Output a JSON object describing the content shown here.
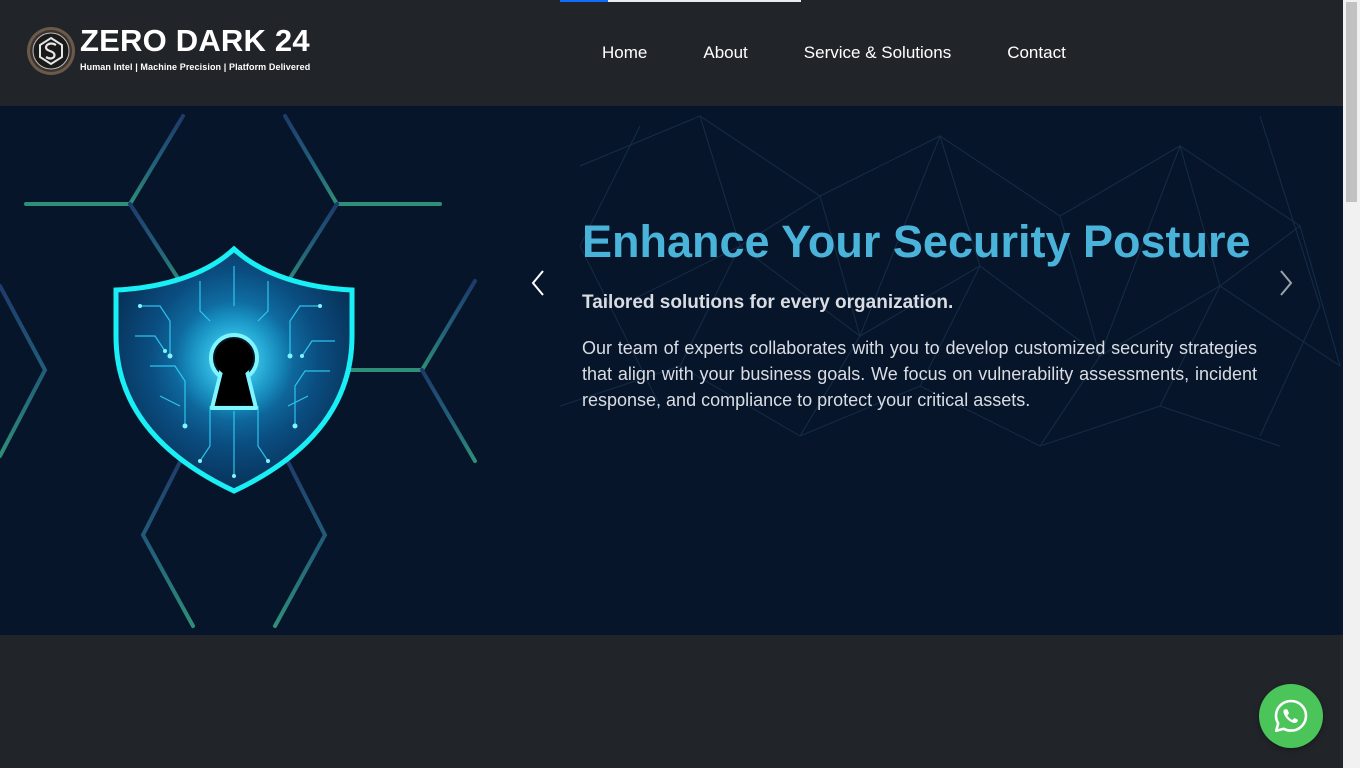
{
  "brand": {
    "name": "ZERO DARK 24",
    "tagline": "Human Intel | Machine Precision | Platform Delivered"
  },
  "nav": {
    "items": [
      {
        "label": "Home"
      },
      {
        "label": "About"
      },
      {
        "label": "Service & Solutions"
      },
      {
        "label": "Contact"
      }
    ]
  },
  "hero": {
    "title": "Enhance Your Security Posture",
    "subtitle": "Tailored solutions for every organization.",
    "body": "Our team of experts collaborates with you to develop customized security strategies that align with your business goals. We focus on vulnerability assessments, incident response, and compliance to protect your critical assets.",
    "prev_icon": "chevron-left-icon",
    "next_icon": "chevron-right-icon",
    "illustration_icon": "shield-keyhole-icon"
  },
  "floating": {
    "whatsapp_icon": "whatsapp-icon"
  },
  "colors": {
    "header_bg": "#212529",
    "hero_bg": "#07152a",
    "title_accent": "#4ab3d9",
    "whatsapp_green": "#4bc55a",
    "shield_cyan": "#19f0f5"
  }
}
